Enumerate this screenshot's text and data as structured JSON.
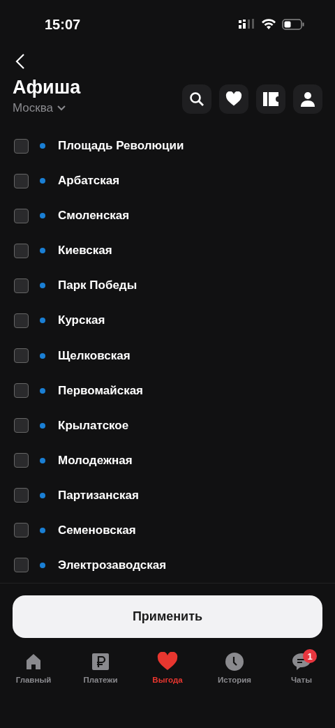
{
  "status_bar": {
    "time": "15:07"
  },
  "header": {
    "title": "Афиша",
    "city": "Москва"
  },
  "stations": [
    {
      "name": "Площадь Революции",
      "checked": false,
      "color": "#1a7fd4"
    },
    {
      "name": "Арбатская",
      "checked": false,
      "color": "#1a7fd4"
    },
    {
      "name": "Смоленская",
      "checked": false,
      "color": "#1a7fd4"
    },
    {
      "name": "Киевская",
      "checked": false,
      "color": "#1a7fd4"
    },
    {
      "name": "Парк Победы",
      "checked": false,
      "color": "#1a7fd4"
    },
    {
      "name": "Курская",
      "checked": false,
      "color": "#1a7fd4"
    },
    {
      "name": "Щелковская",
      "checked": false,
      "color": "#1a7fd4"
    },
    {
      "name": "Первомайская",
      "checked": false,
      "color": "#1a7fd4"
    },
    {
      "name": "Крылатское",
      "checked": false,
      "color": "#1a7fd4"
    },
    {
      "name": "Молодежная",
      "checked": false,
      "color": "#1a7fd4"
    },
    {
      "name": "Партизанская",
      "checked": false,
      "color": "#1a7fd4"
    },
    {
      "name": "Семеновская",
      "checked": false,
      "color": "#1a7fd4"
    },
    {
      "name": "Электрозаводская",
      "checked": false,
      "color": "#1a7fd4"
    }
  ],
  "apply_button": "Применить",
  "tab_bar": [
    {
      "kind": "home",
      "label": "Главный",
      "selected": false
    },
    {
      "kind": "payments",
      "label": "Платежи",
      "selected": false
    },
    {
      "kind": "benefit",
      "label": "Выгода",
      "selected": true
    },
    {
      "kind": "history",
      "label": "История",
      "selected": false
    },
    {
      "kind": "chats",
      "label": "Чаты",
      "selected": false,
      "badge": "1"
    }
  ]
}
